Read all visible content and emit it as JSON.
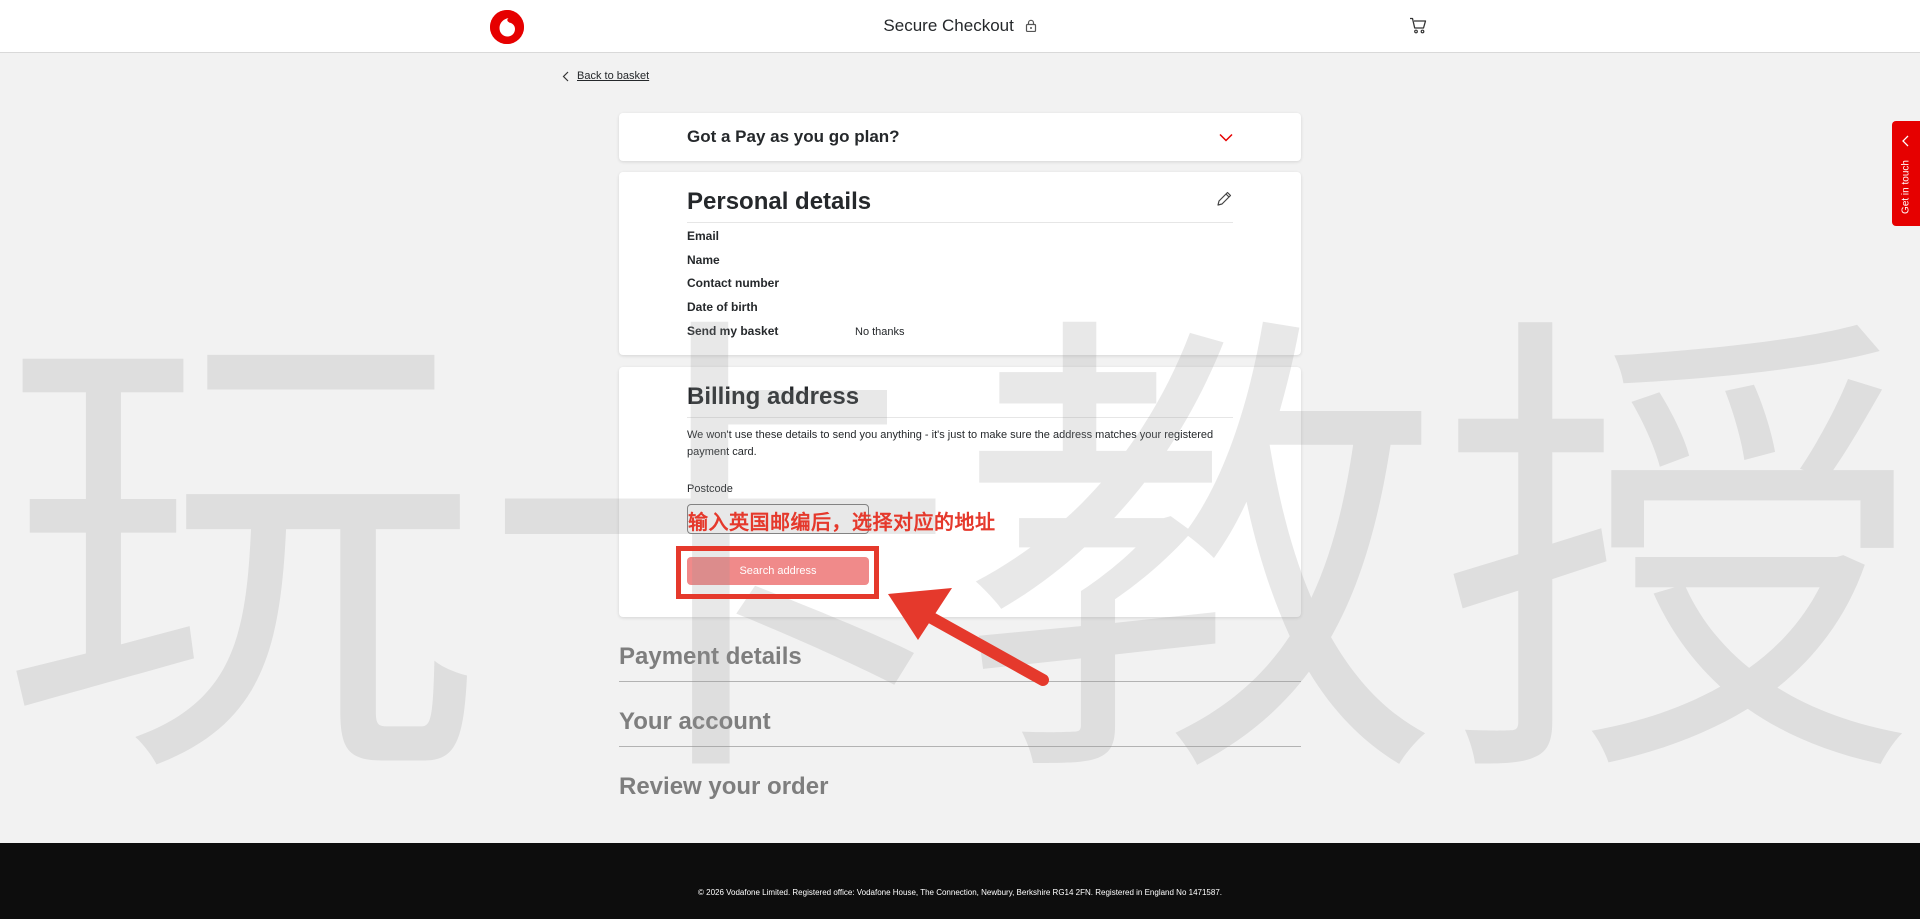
{
  "header": {
    "title": "Secure Checkout",
    "logo_icon": "vodafone-logo",
    "lock_icon": "lock-icon",
    "cart_icon": "cart-icon"
  },
  "back_link": "Back to basket",
  "payg": {
    "title": "Got a Pay as you go plan?"
  },
  "personal": {
    "title": "Personal details",
    "rows": [
      {
        "label": "Email",
        "value": ""
      },
      {
        "label": "Name",
        "value": ""
      },
      {
        "label": "Contact number",
        "value": ""
      },
      {
        "label": "Date of birth",
        "value": ""
      },
      {
        "label": "Send my basket",
        "value": "No thanks"
      }
    ]
  },
  "billing": {
    "title": "Billing address",
    "note": "We won't use these details to send you anything - it's just to make sure the address matches your registered payment card.",
    "postcode_label": "Postcode",
    "postcode_value": "",
    "search_label": "Search address"
  },
  "sections": [
    "Payment details",
    "Your account",
    "Review your order"
  ],
  "side_tab": "Get in touch",
  "footer": "© 2026 Vodafone Limited. Registered office: Vodafone House, The Connection, Newbury, Berkshire RG14 2FN. Registered in England No 1471587.",
  "overlay": {
    "annotation": "输入英国邮编后，选择对应的地址",
    "watermark": "玩卡教授"
  },
  "colors": {
    "brand": "#e60000",
    "annotation": "#e5392c",
    "footer_bg": "#0d0d0d"
  }
}
